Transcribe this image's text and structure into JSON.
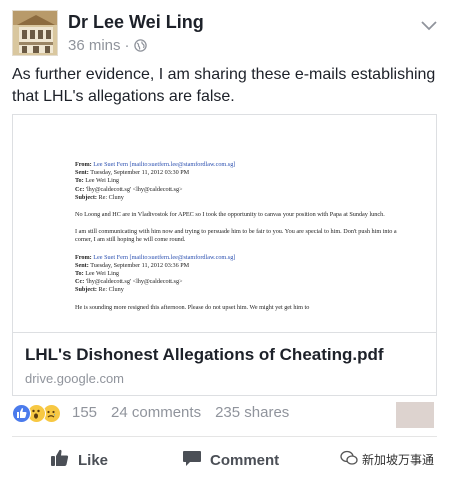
{
  "post": {
    "author": "Dr Lee Wei Ling",
    "time": "36 mins",
    "separator": "·",
    "message": "As further evidence, I am sharing these e-mails establishing that LHL's allegations are false."
  },
  "link_card": {
    "title": "LHL's Dishonest Allegations of Cheating.pdf",
    "domain": "drive.google.com",
    "preview": {
      "email1": {
        "from_label": "From:",
        "from_value": "Lee Suet Fern [mailto:suetfern.lee@stamfordlaw.com.sg]",
        "sent_label": "Sent:",
        "sent_value": "Tuesday, September 11, 2012 03:30 PM",
        "to_label": "To:",
        "to_value": "Lee Wei Ling",
        "cc_label": "Cc:",
        "cc_value": "'lhy@caldecott.sg' <lhy@caldecott.sg>",
        "subject_label": "Subject:",
        "subject_value": "Re: Cluny",
        "body1": "No Loong and HC are in Vladivostok for APEC so I took the opportunity to canvas your position with Papa at Sunday lunch.",
        "body2": "I am still communicating with him now and trying to persuade him to be fair to you.  You are special to him.  Don't push him into a corner,  I am still hoping he will come round."
      },
      "email2": {
        "from_label": "From:",
        "from_value": "Lee Suet Fern [mailto:suetfern.lee@stamfordlaw.com.sg]",
        "sent_label": "Sent:",
        "sent_value": "Tuesday, September 11, 2012 03:36 PM",
        "to_label": "To:",
        "to_value": "Lee Wei Ling",
        "cc_label": "Cc:",
        "cc_value": "'lhy@caldecott.sg' <lhy@caldecott.sg>",
        "subject_label": "Subject:",
        "subject_value": "Re: Cluny",
        "body1": "He is sounding more resigned this afternoon.  Please do not upset him.  We might yet get him to"
      }
    }
  },
  "stats": {
    "reaction_count": "155",
    "comments": "24 comments",
    "shares": "235 shares"
  },
  "actions": {
    "like": "Like",
    "comment": "Comment"
  },
  "watermark": "新加坡万事通",
  "colors": {
    "text": "#1d2129",
    "muted": "#90949c",
    "like_blue": "#4b7bec",
    "emoji_yellow": "#f7c843"
  }
}
